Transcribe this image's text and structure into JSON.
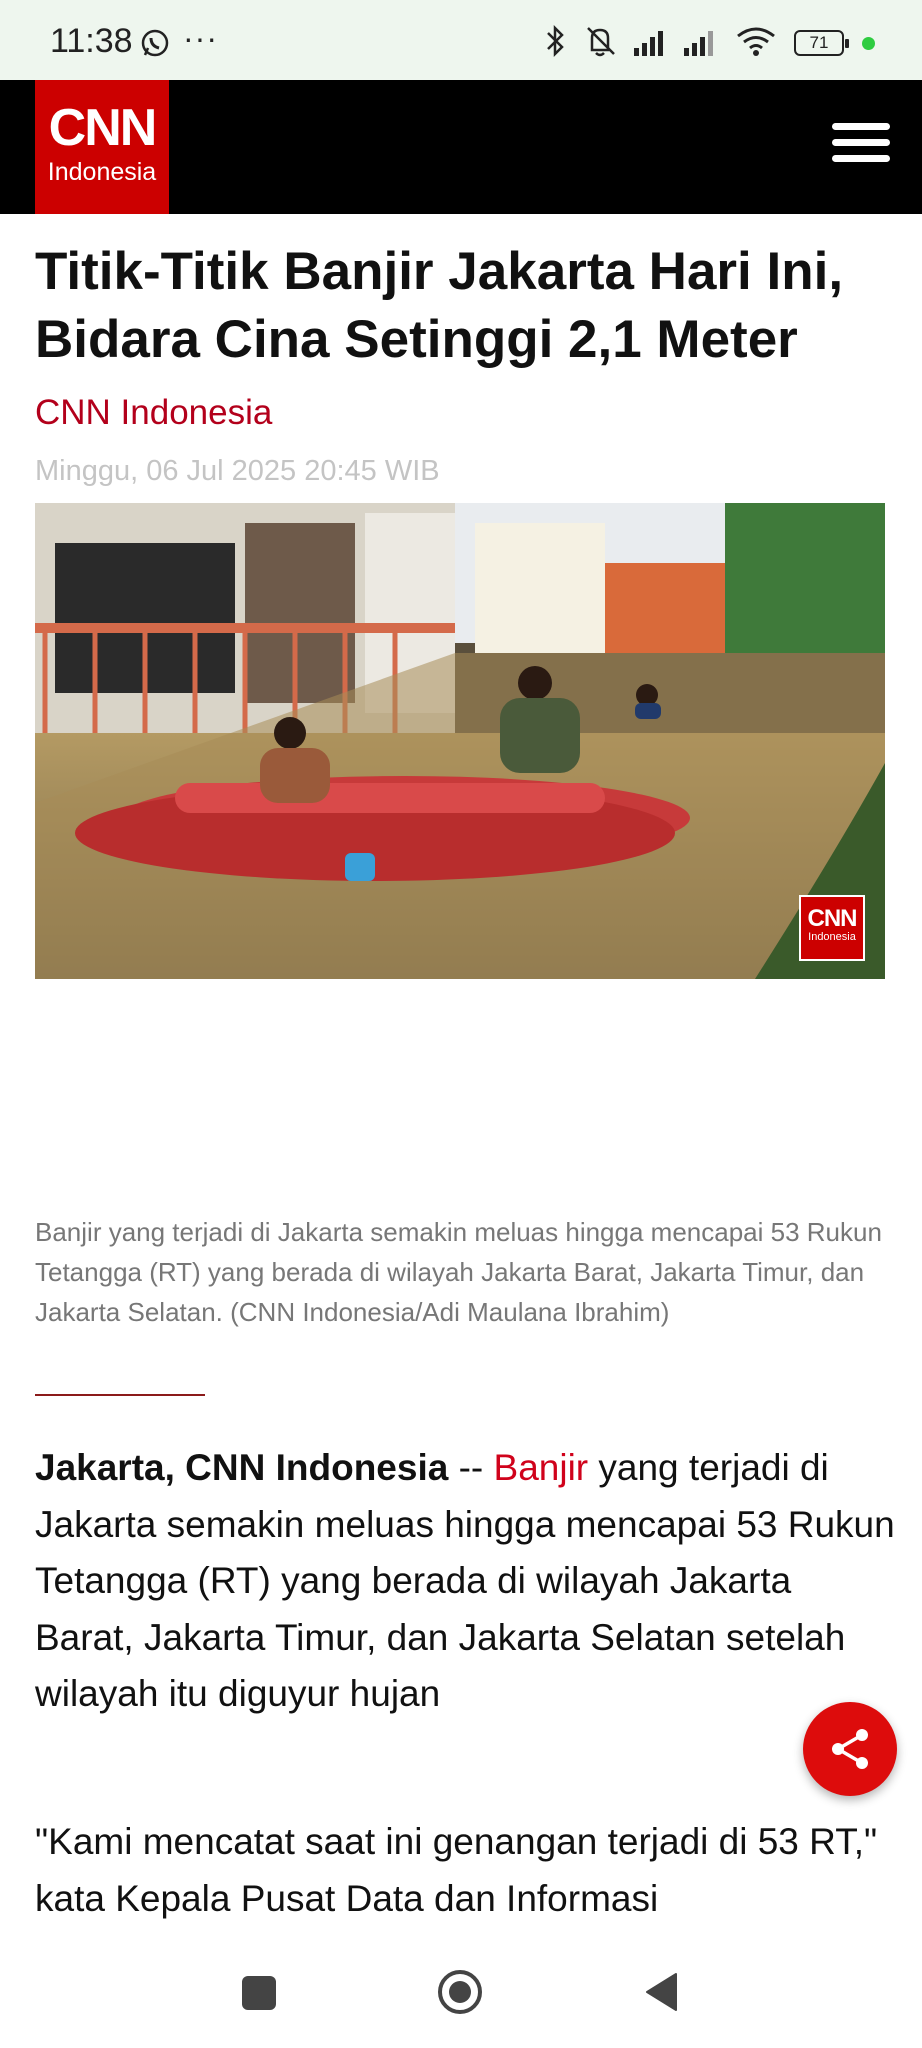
{
  "status_bar": {
    "time": "11:38",
    "dots": "···",
    "battery": "71",
    "icons": [
      "whatsapp-icon",
      "bluetooth-icon",
      "mute-icon",
      "signal-icon",
      "signal-icon",
      "wifi-icon",
      "battery-icon"
    ]
  },
  "header": {
    "logo_main": "CNN",
    "logo_sub": "Indonesia"
  },
  "article": {
    "headline": "Titik-Titik Banjir Jakarta Hari Ini, Bidara Cina Setinggi 2,1 Meter",
    "source": "CNN Indonesia",
    "date": "Minggu, 06 Jul 2025 20:45 WIB",
    "photo_watermark_main": "CNN",
    "photo_watermark_sub": "Indonesia",
    "caption": "Banjir yang terjadi di Jakarta semakin meluas hingga mencapai 53 Rukun Tetangga (RT) yang berada di wilayah Jakarta Barat, Jakarta Timur, dan Jakarta Selatan. (CNN Indonesia/Adi Maulana Ibrahim)",
    "body_lead": "Jakarta, CNN Indonesia",
    "body_sep": " -- ",
    "body_link": "Banjir",
    "body_rest": " yang terjadi di Jakarta semakin meluas hingga mencapai 53 Rukun Tetangga (RT) yang berada di wilayah Jakarta Barat, Jakarta Timur, dan Jakarta Selatan setelah wilayah itu diguyur hujan",
    "body_p2": "\"Kami mencatat saat ini genangan terjadi di 53 RT,\" kata Kepala Pusat Data dan Informasi"
  },
  "colors": {
    "brand_red": "#cc0000",
    "link_red": "#d0021b",
    "header_bg": "#000000"
  }
}
